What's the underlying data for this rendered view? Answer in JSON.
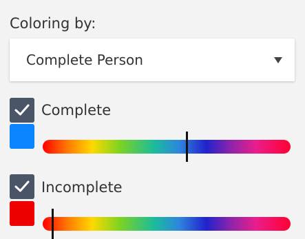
{
  "panel": {
    "coloring_label": "Coloring by:",
    "select": {
      "selected_value": "Complete Person"
    }
  },
  "series": [
    {
      "label": "Complete",
      "checked": true,
      "swatch_color": "#0a84ff",
      "slider_value_fraction": 0.58
    },
    {
      "label": "Incomplete",
      "checked": true,
      "swatch_color": "#ee0000",
      "slider_value_fraction": 0.04
    }
  ],
  "colors": {
    "checkbox_fill": "#4a5568",
    "background": "#f3f3f3"
  },
  "icons": {
    "checkmark": "check-icon",
    "dropdown": "caret-down-icon"
  }
}
